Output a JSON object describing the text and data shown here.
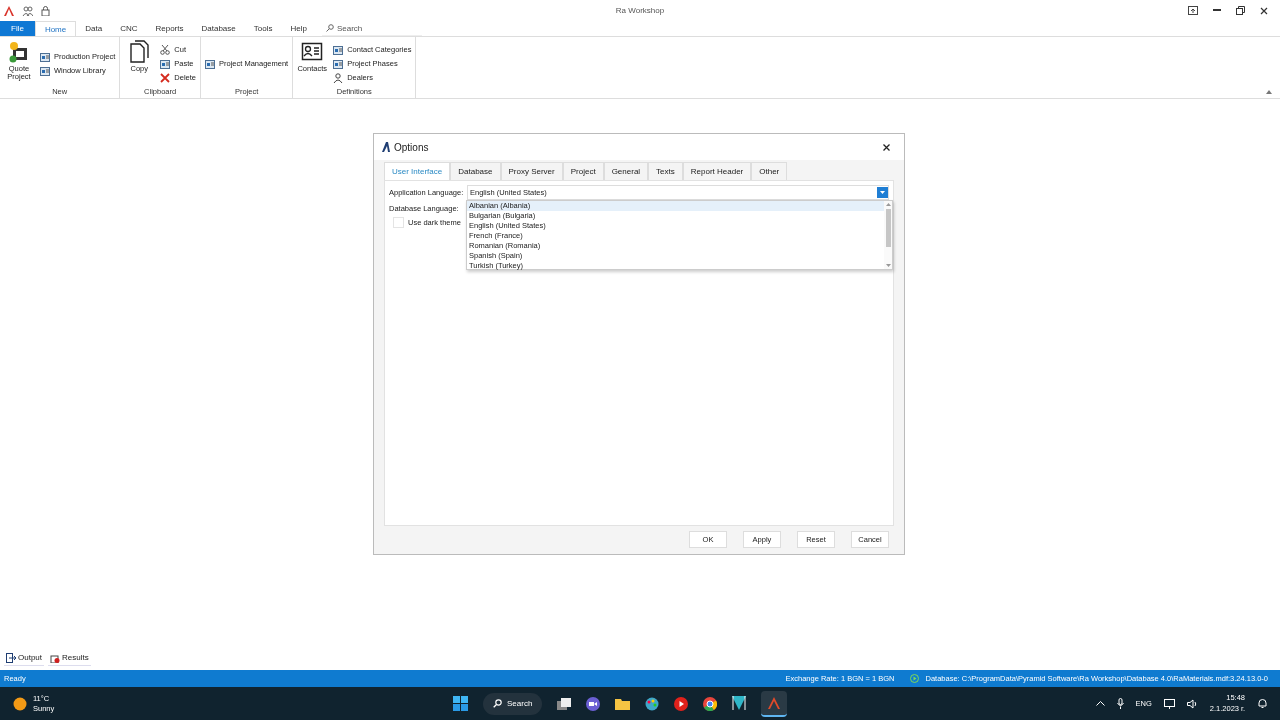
{
  "title_bar": {
    "title": "Ra Workshop"
  },
  "ribbon": {
    "tabs": [
      {
        "label": "File",
        "kind": "file",
        "selected": false
      },
      {
        "label": "Home",
        "kind": "tab",
        "selected": true
      },
      {
        "label": "Data",
        "kind": "tab",
        "selected": false
      },
      {
        "label": "CNC",
        "kind": "tab",
        "selected": false
      },
      {
        "label": "Reports",
        "kind": "tab",
        "selected": false
      },
      {
        "label": "Database",
        "kind": "tab",
        "selected": false
      },
      {
        "label": "Tools",
        "kind": "tab",
        "selected": false
      },
      {
        "label": "Help",
        "kind": "tab",
        "selected": false
      }
    ],
    "search": {
      "placeholder": "Search"
    },
    "groups": [
      {
        "label": "New",
        "items": [
          {
            "label": "Quote Project",
            "kind": "large"
          },
          {
            "label": "Production Project",
            "kind": "small"
          },
          {
            "label": "Window Library",
            "kind": "small"
          }
        ]
      },
      {
        "label": "Clipboard",
        "items": [
          {
            "label": "Copy",
            "kind": "large"
          },
          {
            "label": "Cut",
            "kind": "small"
          },
          {
            "label": "Paste",
            "kind": "small"
          },
          {
            "label": "Delete",
            "kind": "small"
          }
        ]
      },
      {
        "label": "Project",
        "items": [
          {
            "label": "Project Management",
            "kind": "small"
          }
        ]
      },
      {
        "label": "Definitions",
        "items": [
          {
            "label": "Contacts",
            "kind": "large"
          },
          {
            "label": "Contact Categories",
            "kind": "small"
          },
          {
            "label": "Project Phases",
            "kind": "small"
          },
          {
            "label": "Dealers",
            "kind": "small"
          }
        ]
      }
    ]
  },
  "dialog": {
    "title": "Options",
    "tabs": [
      {
        "label": "User Interface",
        "selected": true
      },
      {
        "label": "Database",
        "selected": false
      },
      {
        "label": "Proxy Server",
        "selected": false
      },
      {
        "label": "Project",
        "selected": false
      },
      {
        "label": "General",
        "selected": false
      },
      {
        "label": "Texts",
        "selected": false
      },
      {
        "label": "Report Header",
        "selected": false
      },
      {
        "label": "Other",
        "selected": false
      }
    ],
    "application_language": {
      "label": "Application Language:",
      "value": "English (United States)"
    },
    "database_language": {
      "label": "Database Language:"
    },
    "dark_theme": {
      "label": "Use dark theme",
      "checked": false
    },
    "dropdown": {
      "items": [
        {
          "label": "Albanian (Albania)",
          "selected": true
        },
        {
          "label": "Bulgarian (Bulgaria)",
          "selected": false
        },
        {
          "label": "English (United States)",
          "selected": false
        },
        {
          "label": "French (France)",
          "selected": false
        },
        {
          "label": "Romanian (Romania)",
          "selected": false
        },
        {
          "label": "Spanish (Spain)",
          "selected": false
        },
        {
          "label": "Turkish (Turkey)",
          "selected": false
        }
      ]
    },
    "buttons": [
      "OK",
      "Apply",
      "Reset",
      "Cancel"
    ]
  },
  "bottom_tabs": [
    "Output",
    "Results"
  ],
  "status_bar": {
    "status": "Ready",
    "exchange_rate": "Exchange Rate: 1 BGN = 1 BGN",
    "database": "Database: C:\\ProgramData\\Pyramid Software\\Ra Workshop\\Database 4.0\\RaMaterials.mdf:3.24.13.0-0"
  },
  "taskbar": {
    "weather": {
      "temperature": "11°C",
      "condition": "Sunny"
    },
    "search": "Search",
    "language": "ENG",
    "time": "15:48",
    "date": "2.1.2023 г."
  }
}
